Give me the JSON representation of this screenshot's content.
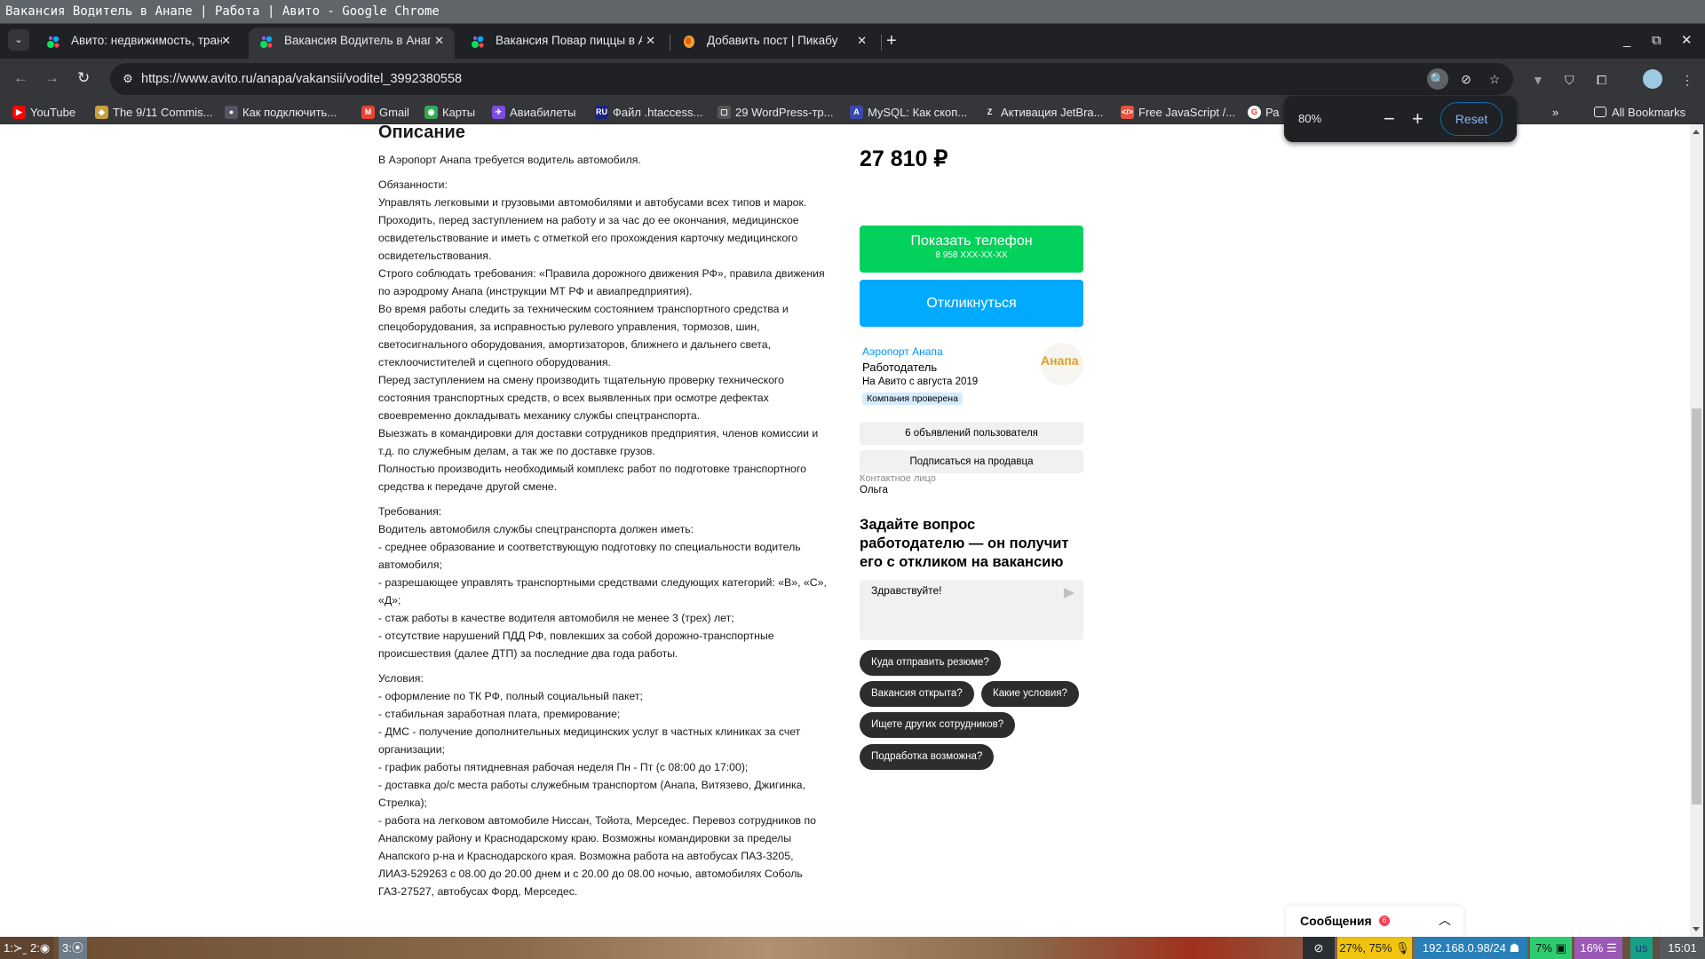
{
  "window": {
    "title": "Вакансия Водитель в Анапе | Работа | Авито - Google Chrome"
  },
  "tabs": [
    {
      "title": "Авито: недвижимость, транспорт",
      "active": false,
      "favicon": "avito-icon"
    },
    {
      "title": "Вакансия Водитель в Анапе",
      "active": true,
      "favicon": "avito-icon"
    },
    {
      "title": "Вакансия Повар пиццы в Анапе",
      "active": false,
      "favicon": "avito-icon"
    },
    {
      "title": "Добавить пост | Пикабу",
      "active": false,
      "favicon": "pikabu-icon"
    }
  ],
  "toolbar": {
    "url": "https://www.avito.ru/anapa/vakansii/voditel_3992380558"
  },
  "bookmarks": [
    {
      "label": "YouTube",
      "color": "#ff0000",
      "glyph": "▶"
    },
    {
      "label": "The 9/11 Commis...",
      "color": "#c8a040",
      "glyph": "◆"
    },
    {
      "label": "Как подключить...",
      "color": "#556",
      "glyph": "●"
    },
    {
      "label": "Gmail",
      "color": "#ea4335",
      "glyph": "M"
    },
    {
      "label": "Карты",
      "color": "#34a853",
      "glyph": "◉"
    },
    {
      "label": "Авиабилеты",
      "color": "#7b4de0",
      "glyph": "✈"
    },
    {
      "label": "Файл .htaccess...",
      "color": "#1a237e",
      "glyph": "RU"
    },
    {
      "label": "29 WordPress-тр...",
      "color": "#555",
      "glyph": "▢"
    },
    {
      "label": "MySQL: Как скоп...",
      "color": "#3949ab",
      "glyph": "A"
    },
    {
      "label": "Активация JetBra...",
      "color": "#35363a",
      "glyph": "Z"
    },
    {
      "label": "Free JavaScript /...",
      "color": "#e5533d",
      "glyph": "</>"
    },
    {
      "label": "Ра",
      "color": "#fff",
      "glyph": "G"
    }
  ],
  "bookmarks_more": "»",
  "all_bookmarks": "All Bookmarks",
  "zoom_popup": {
    "level": "80%",
    "minus": "−",
    "plus": "+",
    "reset": "Reset"
  },
  "description": {
    "heading": "Описание",
    "intro": "В Аэропорт Анапа требуется водитель автомобиля.",
    "duties_title": "Обязанности:",
    "duties": [
      "Управлять легковыми и грузовыми автомобилями и автобусами всех типов и марок.",
      "Проходить, перед заступлением на работу и за час до ее окончания, медицинское освидетельствование и иметь с отметкой его прохождения карточку медицинского освидетельствования.",
      "Строго соблюдать требования: «Правила дорожного движения РФ», правила движения по аэродрому Анапа (инструкции МТ РФ и авиапредприятия).",
      "Во время работы следить за техническим состоянием транспортного средства и спецоборудования, за исправностью рулевого управления, тормозов, шин, светосигнального оборудования, амортизаторов, ближнего и дальнего света, стеклоочистителей и сцепного оборудования.",
      "Перед заступлением на смену производить тщательную проверку технического состояния транспортных средств, о всех выявленных при осмотре дефектах своевременно докладывать механику службы спецтранспорта.",
      "Выезжать в командировки для доставки сотрудников предприятия, членов комиссии и т.д. по служебным делам, а так же по доставке грузов.",
      "Полностью производить необходимый комплекс работ по подготовке транспортного средства к передаче другой смене."
    ],
    "requirements_title": "Требования:",
    "requirements": [
      "Водитель автомобиля службы спецтранспорта должен иметь:",
      "- среднее образование и соответствующую подготовку по специальности водитель автомобиля;",
      "- разрешающее управлять транспортными средствами следующих категорий: «В», «С», «Д»;",
      "- стаж работы в качестве водителя автомобиля не менее 3 (трех) лет;",
      "- отсутствие нарушений ПДД РФ, повлекших за собой дорожно-транспортные происшествия (далее ДТП) за последние два года работы."
    ],
    "conditions_title": "Условия:",
    "conditions": [
      "- оформление по ТК РФ, полный социальный пакет;",
      "- стабильная заработная плата, премирование;",
      "- ДМС - получение дополнительных медицинских услуг в частных клиниках за счет организации;",
      "- график работы пятидневная рабочая неделя Пн - Пт (с 08:00 до 17:00);",
      "- доставка до/с места работы служебным транспортом (Анапа, Витязево, Джигинка, Стрелка);",
      "- работа на легковом автомобиле Ниссан, Тойота, Мерседес. Перевоз сотрудников по Анапскому району и Краснодарскому краю. Возможны командировки за пределы Анапского р-на и Краснодарского края. Возможна работа на автобусах ПАЗ-3205, ЛИАЗ-529263 с 08.00 до 20.00 днем и с 20.00 до 08.00 ночью, автомобилях Соболь ГАЗ-27527, автобусах Форд, Мерседес."
    ]
  },
  "sidebar": {
    "price": "27 810 ₽",
    "show_phone": "Показать телефон",
    "phone_masked": "8 958 XXX-XX-XX",
    "respond": "Откликнуться",
    "seller_name": "Аэропорт Анапа",
    "seller_role": "Работодатель",
    "seller_since": "На Авито с августа 2019",
    "verified": "Компания проверена",
    "logo_text": "Анапа",
    "ads_count": "6 объявлений пользователя",
    "subscribe": "Подписаться на продавца",
    "contact_label": "Контактное лицо",
    "contact_name": "Ольга",
    "ask_title": "Задайте вопрос работодателю — он получит его с откликом на вакансию",
    "message_value": "Здравствуйте!",
    "chips": [
      "Куда отправить резюме?",
      "Вакансия открыта?",
      "Какие условия?",
      "Ищете других сотрудников?",
      "Подработка возможна?"
    ]
  },
  "messages_widget": {
    "label": "Сообщения",
    "badge": "6"
  },
  "colors": {
    "green": "#02d15c",
    "blue": "#00aaff",
    "link": "#0a91f0"
  },
  "taskbar": {
    "workspaces": [
      "1:≻_",
      "2:",
      "3:"
    ],
    "tray": [
      {
        "text": "",
        "icon": "eye-slash-icon",
        "bg": "#2b2f33"
      },
      {
        "text": "27%, 75% 🎙",
        "bg": "#f1c40f",
        "color": "#222"
      },
      {
        "text": "192.168.0.98/24",
        "bg": "#2980b9"
      },
      {
        "text": "7%",
        "bg": "#2ecc71",
        "color": "#111"
      },
      {
        "text": "16% ☰",
        "bg": "#9b59b6"
      },
      {
        "text": "us",
        "bg": "#16a085",
        "color": "#1a3a8a"
      },
      {
        "text": "15:01",
        "bg": "#555a5e"
      }
    ]
  }
}
